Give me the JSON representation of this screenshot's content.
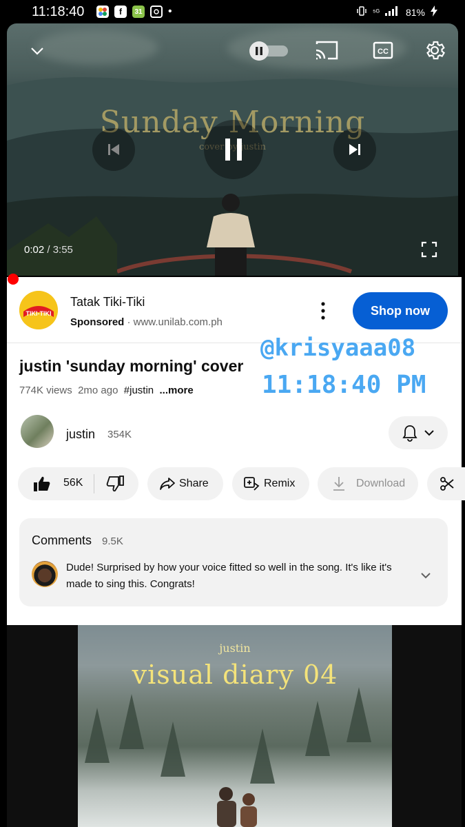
{
  "status_bar": {
    "time": "11:18:40",
    "signal": "⁵ᴳ",
    "battery": "81%"
  },
  "player": {
    "video_title_text": "Sunday Morning",
    "video_subtitle_text": "cover by justin",
    "current_time": "0:02",
    "duration": " / 3:55",
    "progress_fraction": 0.0085
  },
  "ad": {
    "logo_text": "TIKI-TIKI",
    "title": "Tatak Tiki-Tiki",
    "sponsored": "Sponsored",
    "url": " · www.unilab.com.ph",
    "cta": "Shop now"
  },
  "video": {
    "title": "justin 'sunday morning' cover",
    "views": "774K views",
    "age": "2mo ago",
    "hashtag": "#justin",
    "more": "...more"
  },
  "overlay": {
    "handle": "@krisyaaa08",
    "timestamp": "11:18:40 PM"
  },
  "channel": {
    "name": "justin",
    "subscribers": "354K"
  },
  "actions": {
    "likes": "56K",
    "share": "Share",
    "remix": "Remix",
    "download": "Download"
  },
  "comments": {
    "title": "Comments",
    "count": "9.5K",
    "top_comment": "Dude! Surprised by how your voice fitted so well in the song. It's like it's made to sing this. Congrats!"
  },
  "next_video": {
    "subtitle": "justin",
    "title": "visual diary 04"
  },
  "colors": {
    "accent_blue": "#065fd4",
    "progress_red": "#ff0000",
    "overlay_blue": "#4aa8f2"
  }
}
